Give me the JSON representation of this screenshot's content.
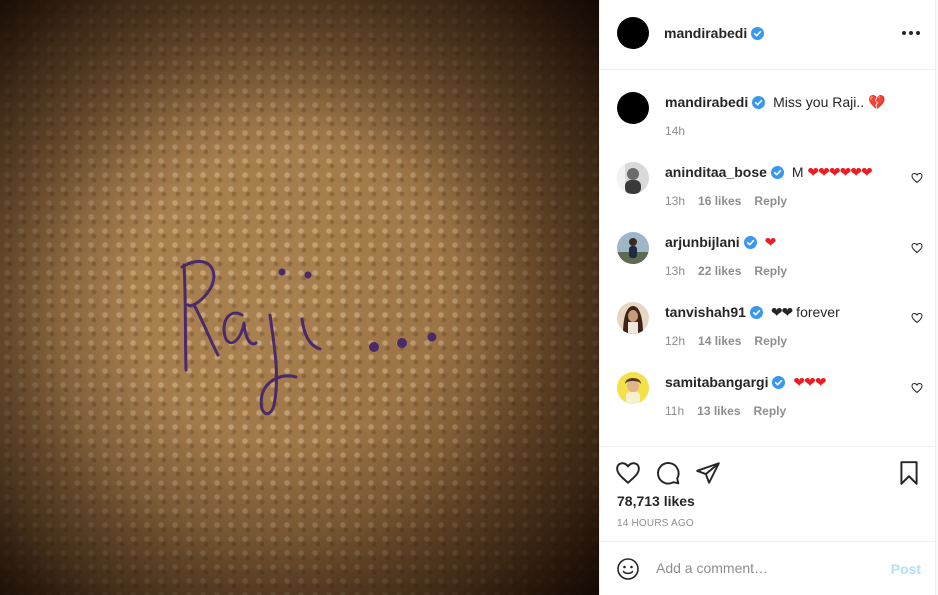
{
  "post": {
    "author": "mandirabedi",
    "author_verified": true,
    "more_icon": "more-horizontal-icon"
  },
  "caption": {
    "username": "mandirabedi",
    "text": "Miss you Raji.. ",
    "emoji": "💔",
    "time": "14h"
  },
  "comments": [
    {
      "username": "aninditaa_bose",
      "text": "M ",
      "hearts": "❤❤❤❤❤❤",
      "time": "13h",
      "likes": "16 likes",
      "reply": "Reply"
    },
    {
      "username": "arjunbijlani",
      "text": "",
      "hearts": "❤",
      "time": "13h",
      "likes": "22 likes",
      "reply": "Reply"
    },
    {
      "username": "tanvishah91",
      "text": " forever",
      "black_hearts": "❤❤",
      "time": "12h",
      "likes": "14 likes",
      "reply": "Reply"
    },
    {
      "username": "samitabangargi",
      "text": "",
      "hearts": "❤❤❤",
      "time": "11h",
      "likes": "13 likes",
      "reply": "Reply"
    }
  ],
  "actions": {
    "likes": "78,713 likes",
    "posted": "14 HOURS AGO"
  },
  "composer": {
    "placeholder": "Add a comment…",
    "post_label": "Post"
  },
  "photo": {
    "handwritten_text": "Raji..."
  },
  "colors": {
    "verified_blue": "#3897f0",
    "heart_red": "#ed1c24",
    "post_disabled": "#b2dffc",
    "muted": "#8e8e8e"
  }
}
